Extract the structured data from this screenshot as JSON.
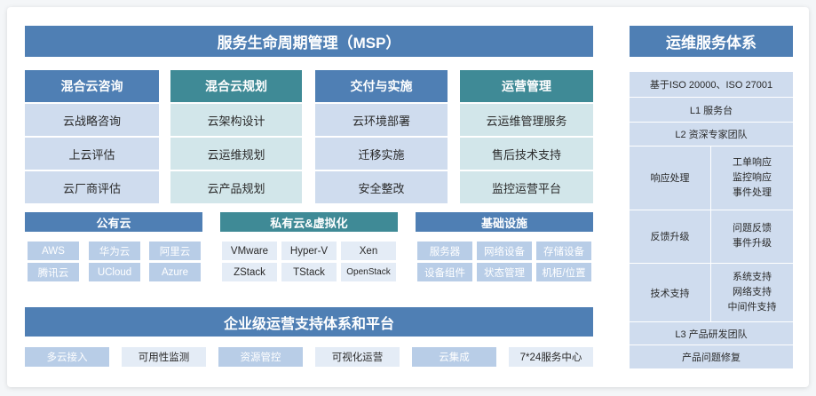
{
  "header": {
    "title": "服务生命周期管理（MSP）",
    "right_title": "运维服务体系"
  },
  "columns": [
    {
      "head": "混合云咨询",
      "items": [
        "云战略咨询",
        "上云评估",
        "云厂商评估"
      ]
    },
    {
      "head": "混合云规划",
      "items": [
        "云架构设计",
        "云运维规划",
        "云产品规划"
      ]
    },
    {
      "head": "交付与实施",
      "items": [
        "云环境部署",
        "迁移实施",
        "安全整改"
      ]
    },
    {
      "head": "运营管理",
      "items": [
        "云运维管理服务",
        "售后技术支持",
        "监控运营平台"
      ]
    }
  ],
  "public_cloud": {
    "head": "公有云",
    "items": [
      "AWS",
      "华为云",
      "阿里云",
      "腾讯云",
      "UCloud",
      "Azure"
    ]
  },
  "private_cloud": {
    "head": "私有云&虚拟化",
    "items": [
      "VMware",
      "Hyper-V",
      "Xen",
      "ZStack",
      "TStack",
      "OpenStack"
    ]
  },
  "infra": {
    "head": "基础设施",
    "items": [
      "服务器",
      "网络设备",
      "存储设备",
      "设备组件",
      "状态管理",
      "机柜/位置"
    ]
  },
  "enterprise": {
    "title": "企业级运营支持体系和平台",
    "items": [
      "多云接入",
      "可用性监测",
      "资源管控",
      "可视化运营",
      "云集成",
      "7*24服务中心"
    ]
  },
  "ops": {
    "rows": [
      "基于ISO 20000、ISO 27001",
      "L1 服务台",
      "L2 资深专家团队"
    ],
    "groups": [
      {
        "label": "响应处理",
        "items": [
          "工单响应",
          "监控响应",
          "事件处理"
        ]
      },
      {
        "label": "反馈升级",
        "items": [
          "问题反馈",
          "事件升级"
        ]
      },
      {
        "label": "技术支持",
        "items": [
          "系统支持",
          "网络支持",
          "中间件支持"
        ]
      }
    ],
    "bottom": [
      "L3 产品研发团队",
      "产品问题修复"
    ]
  }
}
